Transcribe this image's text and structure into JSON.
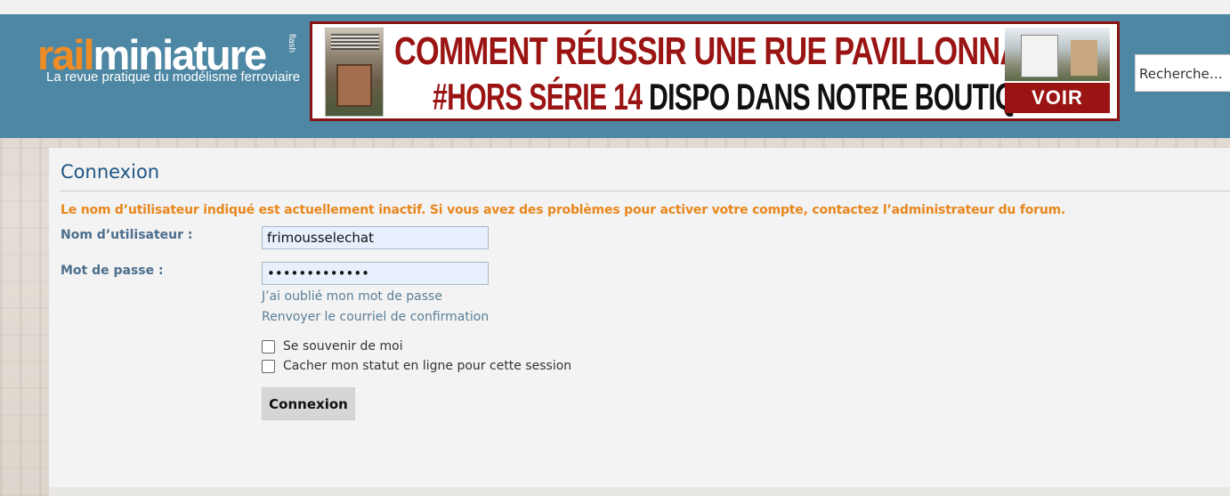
{
  "header": {
    "logo_rail": "rail",
    "logo_miniature": "miniature",
    "logo_flash": "flash",
    "tagline": "La revue pratique du modélisme ferroviaire",
    "search_placeholder": "Recherche…"
  },
  "banner": {
    "line1": "COMMENT RÉUSSIR UNE RUE PAVILLONNAIRE",
    "line2_red": "#HORS SÉRIE 14",
    "line2_black": "DISPO DANS NOTRE BOUTIQUE",
    "cta": "VOIR"
  },
  "login": {
    "title": "Connexion",
    "error": "Le nom d’utilisateur indiqué est actuellement inactif. Si vous avez des problèmes pour activer votre compte, contactez l’administrateur du forum.",
    "username_label": "Nom d’utilisateur :",
    "username_value": "frimousselechat",
    "password_label": "Mot de passe :",
    "password_value": "•••••••••••••",
    "forgot_link": "J’ai oublié mon mot de passe",
    "resend_link": "Renvoyer le courriel de confirmation",
    "remember_label": "Se souvenir de moi",
    "hide_status_label": "Cacher mon statut en ligne pour cette session",
    "submit_label": "Connexion"
  },
  "colors": {
    "header_bg": "#4e87a3",
    "accent_orange": "#f08c24",
    "title_blue": "#1e5585",
    "error_orange": "#e8871e",
    "banner_red": "#9b1414"
  }
}
